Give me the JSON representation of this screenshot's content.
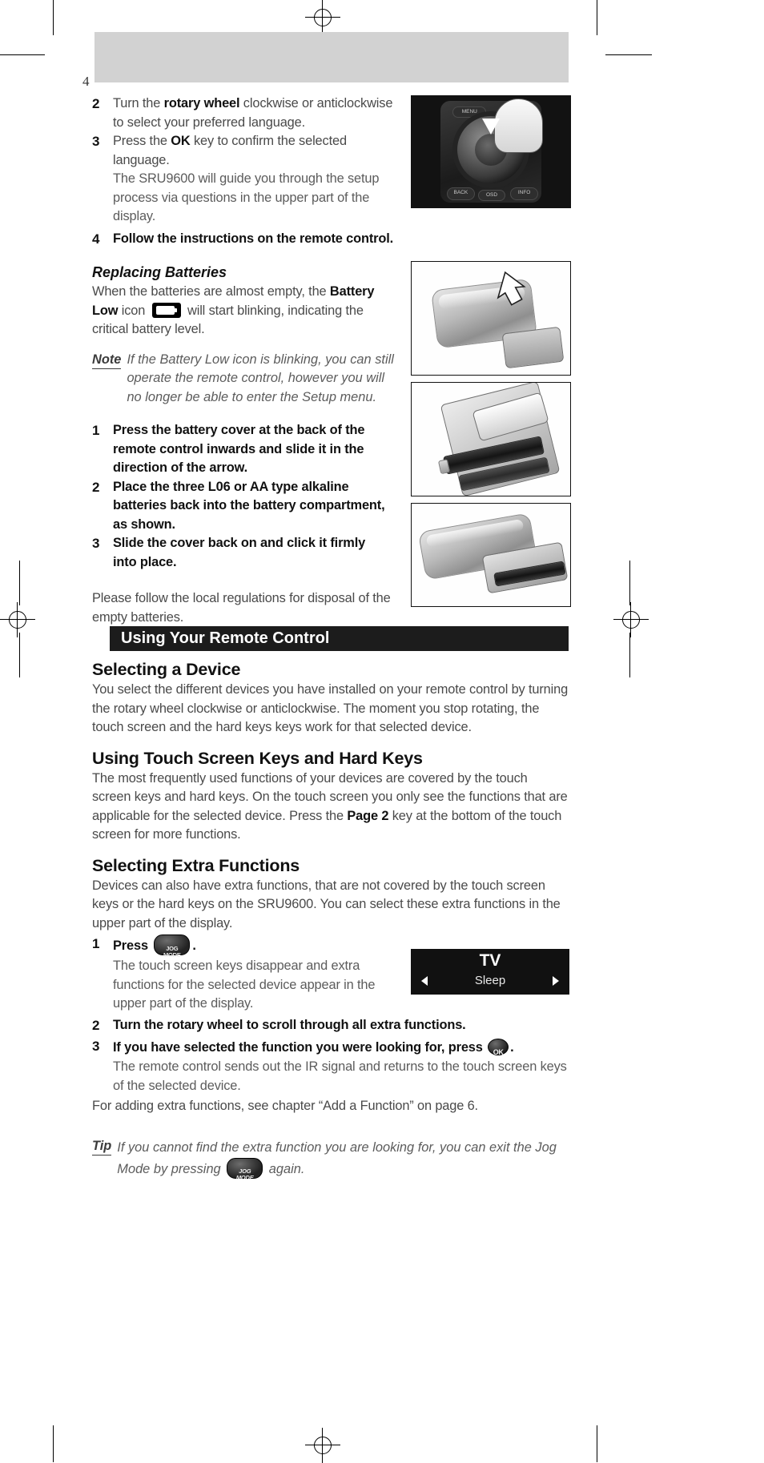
{
  "page": {
    "folio": "4"
  },
  "setup_steps": [
    {
      "num": "2",
      "text_pre": "Turn the ",
      "bold": "rotary wheel",
      "text_post": " clockwise or anticlockwise to select your preferred language."
    },
    {
      "num": "3",
      "text_pre": "Press the ",
      "bold": "OK",
      "text_post": " key to confirm the selected language."
    }
  ],
  "setup_step3_sub": "The SRU9600 will guide you through the setup process via questions in the upper part of the display.",
  "setup_step4": {
    "num": "4",
    "text": "Follow the instructions on the remote control."
  },
  "replacing": {
    "heading": "Replacing Batteries",
    "intro_a": "When the batteries are almost empty, the ",
    "intro_bold1": "Battery Low",
    "intro_b": " icon ",
    "icon_name": "battery-low-icon",
    "intro_c": " will start blinking, indicating the critical battery level.",
    "note_label": "Note",
    "note_body": "If the Battery Low icon is blinking, you can still operate the remote control, however you will no longer be able to enter the Setup menu.",
    "steps": [
      {
        "num": "1",
        "text": "Press the battery cover at the back of the remote control inwards and slide it in the direction of the arrow."
      },
      {
        "num": "2",
        "text": "Place the three L06 or AA type alkaline batteries back into the battery compartment, as shown."
      },
      {
        "num": "3",
        "text": "Slide the cover back on and click it firmly into place."
      }
    ],
    "disposal": "Please follow the local regulations for disposal of the empty batteries."
  },
  "section_bar": {
    "title": "Using Your Remote Control"
  },
  "selecting_device": {
    "heading": "Selecting a Device",
    "body": "You select the different devices you have installed on your remote control by turning the rotary wheel clockwise or anticlockwise. The moment you stop rotating, the touch screen and the hard keys keys work for that selected device."
  },
  "touch_keys": {
    "heading": "Using Touch Screen Keys and Hard Keys",
    "body_a": "The most frequently used functions of your devices are covered by the touch screen keys and hard keys. On the touch screen you only see the functions that are applicable for the selected device. Press the ",
    "body_bold": "Page 2",
    "body_b": " key at the bottom of the touch screen for more functions."
  },
  "extra_functions": {
    "heading": "Selecting Extra Functions",
    "body": "Devices can also have extra functions, that are not covered by the touch screen keys or the hard keys on the SRU9600. You can select these extra functions in the upper part of the display.",
    "step1_num": "1",
    "step1_pre": "Press ",
    "step1_icon": "jog-mode-icon",
    "step1_post": ".",
    "step1_sub": "The touch screen keys disappear and extra functions for the selected device appear in the upper part of the display.",
    "step2_num": "2",
    "step2_text": "Turn the rotary wheel to scroll through all extra functions.",
    "step3_num": "3",
    "step3_pre": "If you have selected the function you were looking for, press ",
    "step3_icon": "ok-key-icon",
    "step3_post": ".",
    "step3_sub": "The remote control sends out the IR signal and returns to the touch screen keys of the selected device.",
    "closing": "For adding extra functions, see chapter “Add a Function” on page 6."
  },
  "tip": {
    "label": "Tip",
    "body_a": "If you cannot find the extra function you are looking for, you can exit the Jog Mode by pressing ",
    "icon": "jog-mode-icon",
    "body_b": " again."
  },
  "lcd": {
    "device": "TV",
    "function": "Sleep",
    "left_arrow": "◀",
    "right_arrow": "▶"
  },
  "jog_icon_label": {
    "line1": "JOG",
    "line2": "MODE"
  },
  "ok_icon_label": "OK",
  "photo_captions": {
    "photo1": "remote-control-rotary-wheel-photo",
    "photo2": "battery-cover-slide-photo",
    "photo3": "battery-insert-photo",
    "photo4": "battery-cover-close-photo"
  },
  "colors": {
    "section_bar_bg": "#1c1c1c",
    "header_band": "#d2d2d2",
    "body_text": "#4a4a4a",
    "heading_text": "#111111",
    "lcd_bg": "#111111"
  }
}
